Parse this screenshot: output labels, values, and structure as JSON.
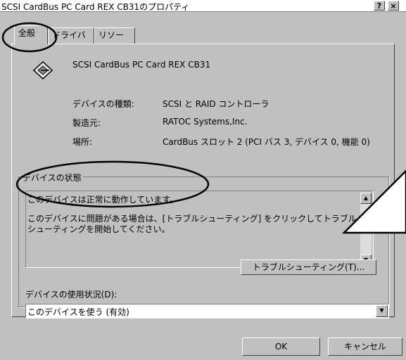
{
  "window": {
    "title": "SCSI CardBus PC Card REX CB31のプロパティ",
    "help_button": "?",
    "close_button": "×"
  },
  "tabs": [
    {
      "label": "全般",
      "active": true
    },
    {
      "label": "ドライバ",
      "active": false
    },
    {
      "label": "リソース",
      "active": false
    }
  ],
  "device": {
    "name": "SCSI CardBus PC Card REX CB31",
    "icon": "scsi-device-icon",
    "fields": [
      {
        "label": "デバイスの種類:",
        "value": "SCSI と RAID コントローラ"
      },
      {
        "label": "製造元:",
        "value": "RATOC Systems,Inc."
      },
      {
        "label": "場所:",
        "value": "CardBus スロット 2 (PCI バス 3, デバイス 0, 機能 0)"
      }
    ]
  },
  "status": {
    "group_title": "デバイスの状態",
    "line1": "このデバイスは正常に動作しています。",
    "line2": "このデバイスに問題がある場合は、[トラブルシューティング] をクリックしてトラブル",
    "line3": "シューティングを開始してください。",
    "troubleshoot_button": "トラブルシューティング(T)..."
  },
  "usage": {
    "label": "デバイスの使用状況(D):",
    "selected": "このデバイスを使う (有効)"
  },
  "buttons": {
    "ok": "OK",
    "cancel": "キャンセル"
  },
  "colors": {
    "face": "#c0c0c0",
    "annotation": "#000000"
  }
}
